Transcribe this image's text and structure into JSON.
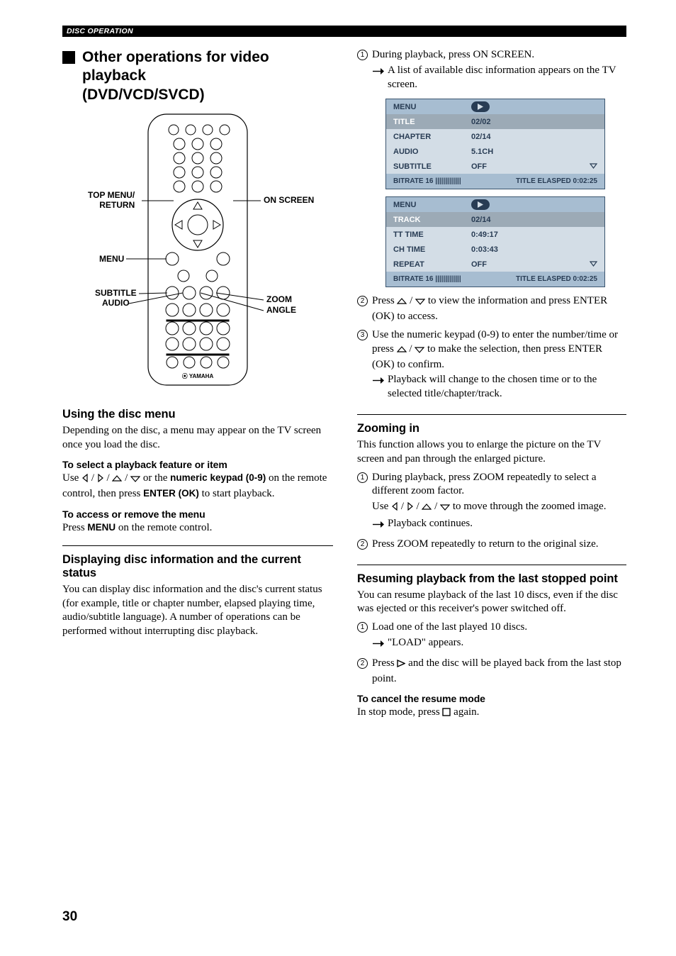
{
  "header": {
    "breadcrumb": "DISC OPERATION"
  },
  "sectionTitle": {
    "l1": "Other operations for video playback",
    "l2": "(DVD/VCD/SVCD)"
  },
  "remoteCallouts": {
    "topmenu": "TOP MENU/\nRETURN",
    "onscreen": "ON SCREEN",
    "menu": "MENU",
    "subtitle": "SUBTITLE",
    "audio": "AUDIO",
    "zoom": "ZOOM",
    "angle": "ANGLE"
  },
  "left": {
    "usingDiscMenu": {
      "heading": "Using the disc menu",
      "p1": "Depending on the disc, a menu may appear on the TV screen once you load the disc.",
      "h3a": "To select a playback feature or item",
      "p2a": "Use ",
      "p2b": " or the ",
      "p2c": "numeric keypad (0-9)",
      "p2d": " on the remote control, then press ",
      "p2e": "ENTER (OK)",
      "p2f": " to start playback.",
      "h3b": "To access or remove the menu",
      "p3a": "Press ",
      "p3b": "MENU",
      "p3c": " on the remote control."
    },
    "displaying": {
      "heading": "Displaying disc information and the current status",
      "p": "You can display disc information and the disc's current status (for example, title or chapter number, elapsed playing time, audio/subtitle language). A number of operations can be performed without interrupting disc playback."
    }
  },
  "right": {
    "step1": {
      "text_a": "During playback, press ",
      "text_b": "ON SCREEN",
      "text_c": ".",
      "arrow_a": "A list of available disc information appears on the TV screen."
    },
    "osd1": {
      "menu": "MENU",
      "rows": [
        {
          "label": "TITLE",
          "value": "02/02",
          "sel": true
        },
        {
          "label": "CHAPTER",
          "value": "02/14"
        },
        {
          "label": "AUDIO",
          "value": "5.1CH"
        },
        {
          "label": "SUBTITLE",
          "value": "OFF",
          "tri": true
        }
      ],
      "footer_left": "BITRATE 16 |||||||||||||",
      "footer_right": "TITLE ELASPED 0:02:25"
    },
    "osd2": {
      "menu": "MENU",
      "rows": [
        {
          "label": "TRACK",
          "value": "02/14",
          "sel": true
        },
        {
          "label": "TT TIME",
          "value": "0:49:17"
        },
        {
          "label": "CH TIME",
          "value": "0:03:43"
        },
        {
          "label": "REPEAT",
          "value": "OFF",
          "tri": true
        }
      ],
      "footer_left": "BITRATE 16 |||||||||||||",
      "footer_right": "TITLE ELASPED 0:02:25"
    },
    "step2": {
      "a": "Press ",
      "b": " to view the information and press ",
      "c": "ENTER (OK)",
      "d": " to access."
    },
    "step3": {
      "a": "Use the ",
      "b": "numeric keypad (0-9)",
      "c": " to enter the number/time or press ",
      "d": " to make the selection, then press ",
      "e": "ENTER (OK)",
      "f": " to confirm.",
      "arrow": "Playback will change to the chosen time or to the selected title/chapter/track."
    },
    "zoom": {
      "heading": "Zooming in",
      "p": "This function allows you to enlarge the picture on the TV screen and pan through the enlarged picture.",
      "s1a": "During playback, press ",
      "s1b": "ZOOM",
      "s1c": " repeatedly to select a different zoom factor.",
      "s1d": "Use ",
      "s1e": " to move through the zoomed image.",
      "s1f": "Playback continues.",
      "s2a": "Press ",
      "s2b": "ZOOM",
      "s2c": " repeatedly to return to the original size."
    },
    "resume": {
      "heading": "Resuming playback from the last stopped point",
      "p": "You can resume playback of the last 10 discs, even if the disc was ejected or this receiver's power switched off.",
      "s1": "Load one of the last played 10 discs.",
      "s1arrow": "\"LOAD\" appears.",
      "s2a": "Press ",
      "s2b": " and the disc will be played back from the last stop point.",
      "h3": "To cancel the resume mode",
      "p2a": "In stop mode, press ",
      "p2b": " again."
    }
  },
  "pageNumber": "30"
}
